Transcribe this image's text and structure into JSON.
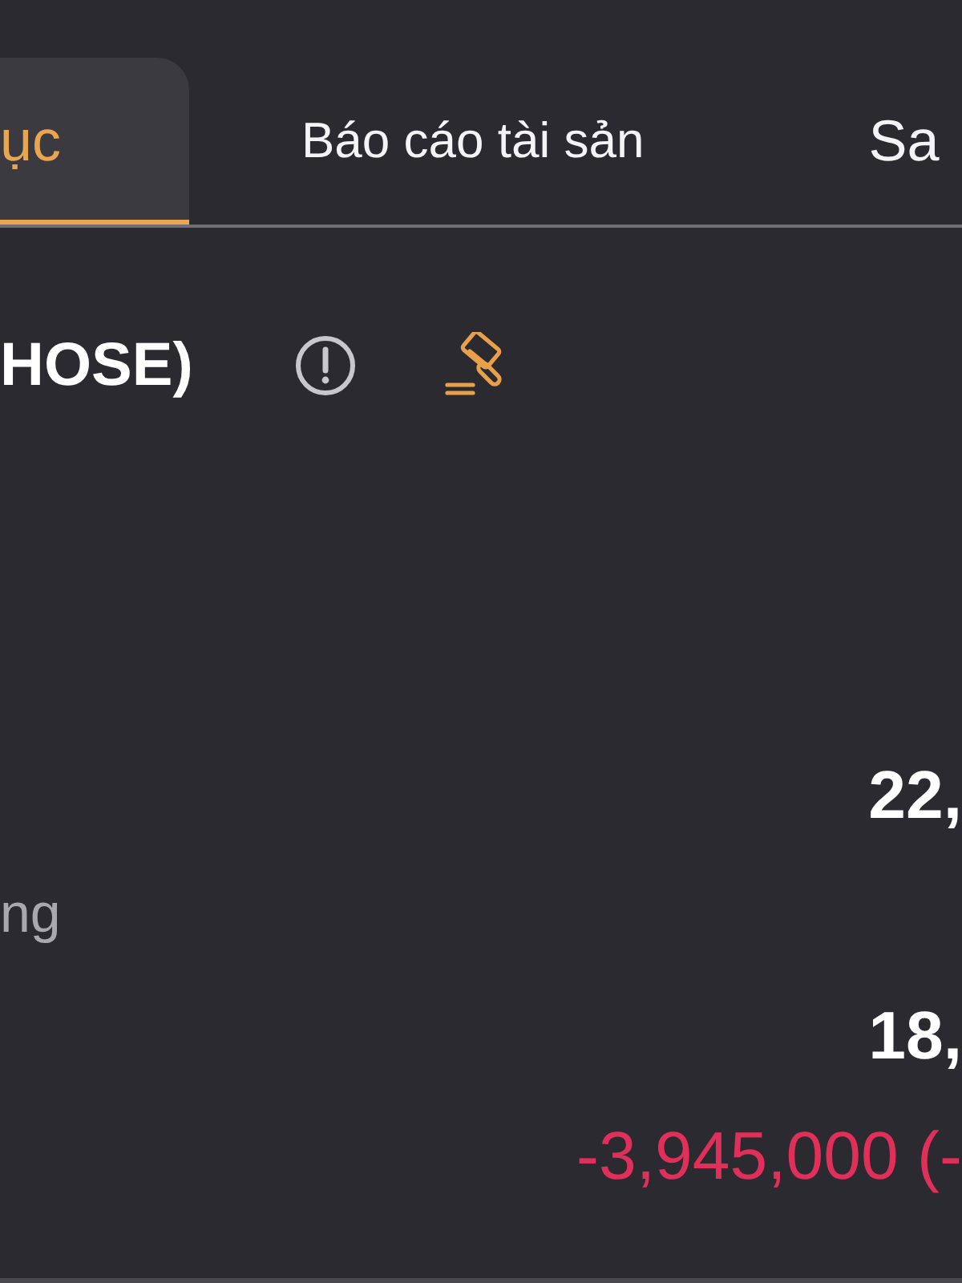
{
  "tabs": [
    {
      "label": "ục",
      "selected": true
    },
    {
      "label": "Báo cáo tài sản",
      "selected": false
    },
    {
      "label": "Sa",
      "selected": false
    }
  ],
  "section": {
    "title": "HOSE)"
  },
  "lines": [
    {
      "kind": "value",
      "text": "22,"
    },
    {
      "kind": "label",
      "text": "ng"
    },
    {
      "kind": "value",
      "text": "18,"
    },
    {
      "kind": "change",
      "text": "-3,945,000 (-"
    }
  ]
}
